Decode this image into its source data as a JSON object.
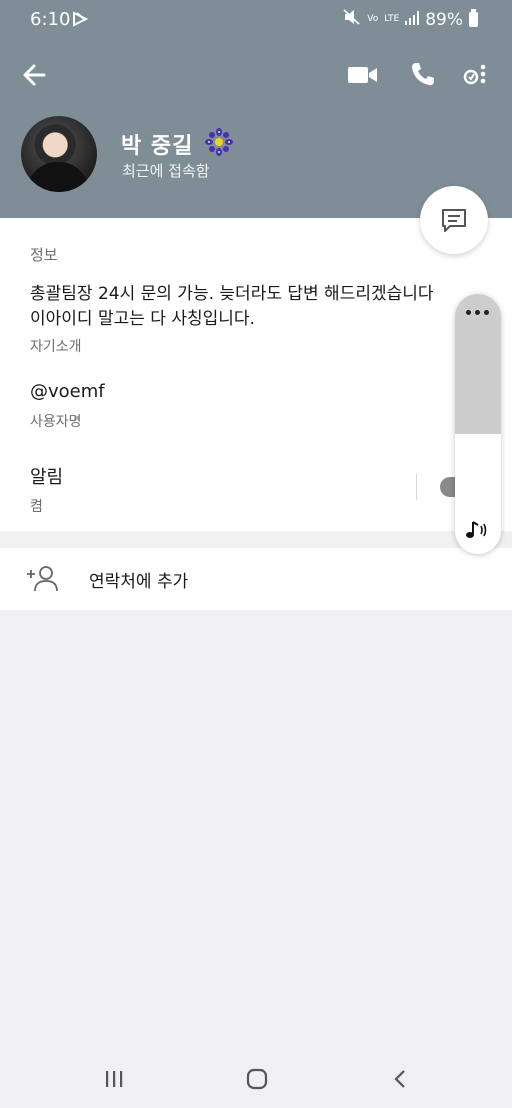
{
  "status_bar": {
    "time": "6:10",
    "network_top": "LTE",
    "network_sub": "Vo",
    "battery": "89%"
  },
  "header": {
    "background_color": "#7e8d96",
    "back_icon": "arrow-left-icon",
    "video_icon": "video-camera-icon",
    "call_icon": "phone-icon",
    "more_icon": "more-vertical-icon"
  },
  "profile": {
    "name": "박 중길",
    "status": "최근에 접속함",
    "badge_icon": "sparkle-flower-icon"
  },
  "info": {
    "section_title": "정보",
    "bio_line1": "총괄팀장 24시 문의 가능. 늦더라도 답변 해드리겠습니다",
    "bio_line2": "이아이디 말고는 다 사칭입니다.",
    "bio_caption": "자기소개",
    "username": "@voemf",
    "username_caption": "사용자명",
    "notification_label": "알림",
    "notification_state": "켬"
  },
  "actions": {
    "add_contact_label": "연락처에 추가",
    "add_contact_icon": "add-person-icon"
  },
  "volume_panel": {
    "level_percent": 54,
    "icon": "music-note-volume-icon"
  },
  "nav_bar": {
    "recents_icon": "recents-icon",
    "home_icon": "home-icon",
    "back_icon": "chevron-left-icon"
  }
}
